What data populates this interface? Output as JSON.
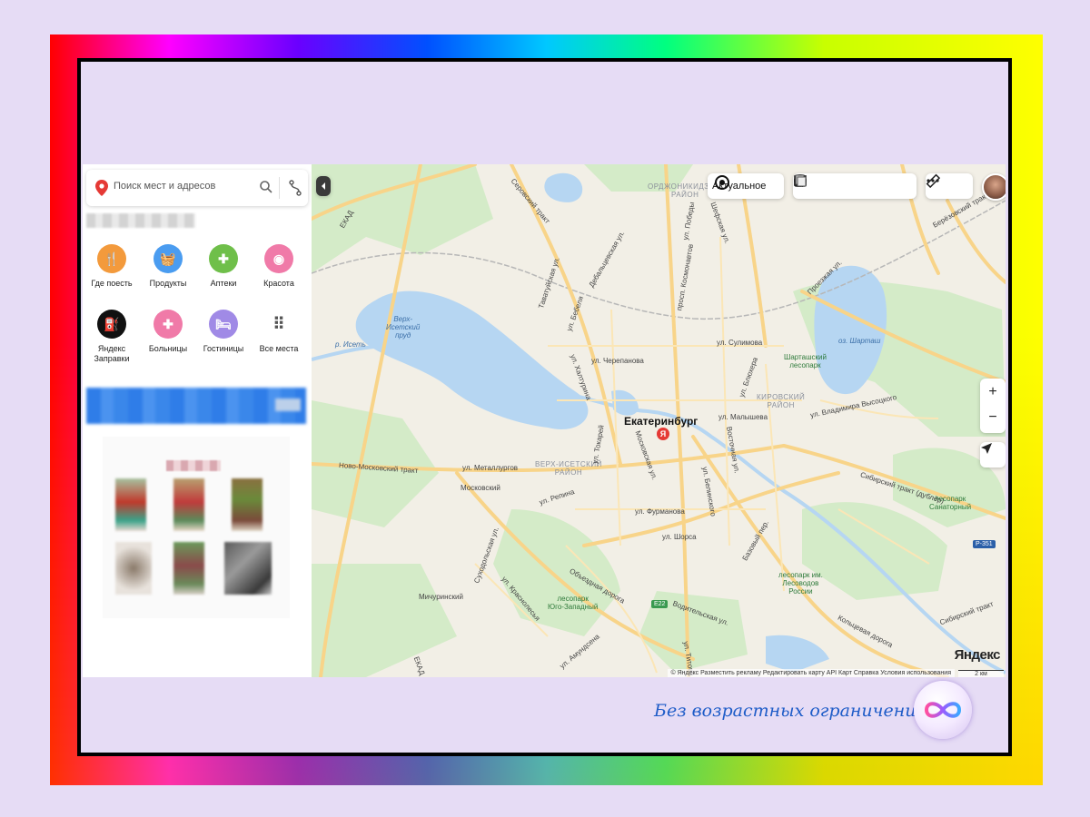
{
  "search": {
    "placeholder": "Поиск мест и адресов"
  },
  "categories": [
    {
      "label": "Где поесть",
      "color": "#f39a3c",
      "icon": "fork-knife-icon",
      "glyph": "🍴"
    },
    {
      "label": "Продукты",
      "color": "#4a9cf0",
      "icon": "basket-icon",
      "glyph": "🧺"
    },
    {
      "label": "Аптеки",
      "color": "#6fbf4a",
      "icon": "plus-icon",
      "glyph": "✚"
    },
    {
      "label": "Красота",
      "color": "#f07aa8",
      "icon": "lips-icon",
      "glyph": "◉"
    },
    {
      "label": "Яндекс Заправки",
      "color": "#111111",
      "icon": "fuel-icon",
      "glyph": "⛽"
    },
    {
      "label": "Больницы",
      "color": "#f07aa8",
      "icon": "plus-icon",
      "glyph": "✚"
    },
    {
      "label": "Гостиницы",
      "color": "#a08ae6",
      "icon": "bed-icon",
      "glyph": "🛏"
    },
    {
      "label": "Все места",
      "color": "#ffffff",
      "icon": "grid-dots-icon",
      "glyph": "⠿"
    }
  ],
  "map": {
    "actual_label": "Актуальное",
    "city": "Екатеринбург",
    "brand": "Яндекс",
    "scale": "2 км",
    "footer": "© Яндекс  Разместить рекламу  Редактировать карту  API Карт  Справка  Условия использования",
    "zoom_in": "+",
    "zoom_out": "−",
    "road_badges": [
      "E22",
      "P-351"
    ],
    "labels": {
      "ordzhonikidze": "ОРДЖОНИКИДЗЕВ-\nРАЙОН",
      "verkh_isetsky_rayon": "ВЕРХ-ИСЕТСКИЙ\nРАЙОН",
      "kirovsky": "КИРОВСКИЙ\nРАЙОН",
      "verkh_pond": "Верх-\nИсетский\nпруд",
      "shartash": "оз. Шарташ",
      "iset": "р. Исеть",
      "shartash_park": "Шарташский\nлесопарк",
      "sanatorny": "лесопарк\nСанаторный",
      "lesovodov": "лесопарк им.\nЛесоводов\nРоссии",
      "yugozapadny": "лесопарк\nЮго-Западный",
      "moskovsky": "Московский",
      "michurinsky": "Мичуринский",
      "ekad": "ЕКАД",
      "serovsky": "Серовский тракт",
      "novomoskovsky": "Ново-Московский тракт",
      "metallurgov": "ул. Металлургов",
      "sibirsky": "Сибирский тракт (дублёр)",
      "vysotskogo": "ул. Владимира Высоцкого",
      "malysheva": "ул. Малышева",
      "furmanova": "ул. Фурманова",
      "repina": "ул. Репина",
      "shorsa": "ул. Шорса",
      "sulimova": "ул. Сулимова",
      "kolcevaya": "Кольцевая дорога",
      "vodit": "Водительская ул.",
      "obezdnaya": "Объездная дорога",
      "bazovy": "Базовый пер.",
      "prosp_kosmonavtov": "просп. Космонавтов",
      "shefskaya": "Шефская ул.",
      "tavatuyskaya": "Таватуйская ул.",
      "khalturina": "ул. Халтурина",
      "tokarey": "ул. Токарей",
      "cherepanova": "ул. Черепанова",
      "bluhera": "ул. Блюхера",
      "vostochnaya": "Восточная ул.",
      "moskovskaya": "Московская ул.",
      "pobedy": "ул. Победы",
      "proezzhaya": "Проезжая ул.",
      "beresovsky": "Берёзовский тракт",
      "titova": "ул. Титова",
      "amundsena": "ул. Амундсена",
      "krasnolesya": "ул. Краснолесья",
      "suhodolskaya": "Суходольская ул.",
      "belinskogo": "ул. Белинского",
      "debalcevskaya": "Дебальцевская ул.",
      "bebelya": "ул. Бебеля",
      "sortirovochny": "Сибирский тракт"
    }
  },
  "caption": "Без возрастных ограничений",
  "colors": {
    "accent": "#1e5cc8",
    "pin": "#e53935",
    "water": "#b6d6f2",
    "park": "#cfe8c2",
    "road": "#fbd98a"
  }
}
